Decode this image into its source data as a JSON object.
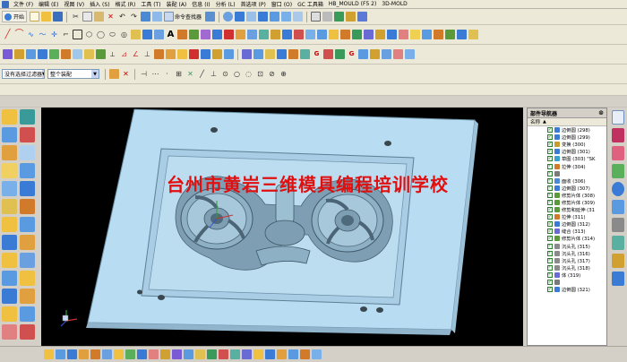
{
  "menu": {
    "items": [
      "文件 (F)",
      "编辑 (E)",
      "视图 (V)",
      "插入 (S)",
      "格式 (R)",
      "工具 (T)",
      "装配 (A)",
      "信息 (I)",
      "分析 (L)",
      "首选项 (P)",
      "窗口 (O)",
      "GC 工具箱",
      "HB_MOULD (F5 2)",
      "3D-MOLD"
    ]
  },
  "toolbar1": {
    "start_label": "开始",
    "assembly_nav_label": "命令查找器"
  },
  "selection_bar": {
    "filter_value": "没有选择过滤器",
    "scope_value": "整个装配"
  },
  "watermark": {
    "text": "台州市黄岩三维模具编程培训学校"
  },
  "part_navigator": {
    "title": "部件导航器",
    "column_header": "名称",
    "rows": [
      {
        "label": "边倒圆 (298)",
        "color": "#3a7bd5"
      },
      {
        "label": "边倒圆 (299)",
        "color": "#3a7bd5"
      },
      {
        "label": "变换 (300)",
        "color": "#c89b2f"
      },
      {
        "label": "边倒圆 (301)",
        "color": "#3a7bd5"
      },
      {
        "label": "草图 (303) \"SK",
        "color": "#3aa0d0"
      },
      {
        "label": "拉伸 (304)",
        "color": "#d07a2a"
      },
      {
        "label": "",
        "color": "#7a7a7a"
      },
      {
        "label": "面收 (306)",
        "color": "#4a8ad5"
      },
      {
        "label": "边倒圆 (307)",
        "color": "#3a7bd5"
      },
      {
        "label": "修剪片体 (308)",
        "color": "#5a9a3a"
      },
      {
        "label": "修剪片体 (309)",
        "color": "#5a9a3a"
      },
      {
        "label": "修剪和延伸 (31",
        "color": "#5a9a3a"
      },
      {
        "label": "拉伸 (311)",
        "color": "#d07a2a"
      },
      {
        "label": "边倒圆 (312)",
        "color": "#3a7bd5"
      },
      {
        "label": "缝合 (313)",
        "color": "#6a6ad5"
      },
      {
        "label": "修剪片体 (314)",
        "color": "#5a9a3a"
      },
      {
        "label": "沉头孔 (315)",
        "color": "#8a8a8a"
      },
      {
        "label": "沉头孔 (316)",
        "color": "#8a8a8a"
      },
      {
        "label": "沉头孔 (317)",
        "color": "#8a8a8a"
      },
      {
        "label": "沉头孔 (318)",
        "color": "#8a8a8a"
      },
      {
        "label": "体 (319)",
        "color": "#6a6ad5"
      },
      {
        "label": "",
        "color": "#7a7a7a"
      },
      {
        "label": "边倒圆 (321)",
        "color": "#3a7bd5"
      }
    ]
  },
  "colors": {
    "viewport_bg": "#000000",
    "plate": "#b8dcf2",
    "plate_edge": "#6a8fa6",
    "pocket": "#a9cde4",
    "cavity": "#7e9fb3",
    "watermark": "#e01010"
  },
  "icons": {
    "toolbar1": [
      "folder-open-icon",
      "save-icon",
      "cut-icon",
      "copy-icon",
      "paste-icon",
      "delete-icon",
      "undo-icon",
      "redo-icon",
      "repeat-icon",
      "find-icon",
      "cube-view-icon",
      "shaded-icon",
      "layer-icon",
      "window-icon"
    ],
    "left": [
      "sketch-icon",
      "extrude-icon",
      "revolve-icon",
      "hole-icon",
      "boss-icon",
      "pocket-icon",
      "pad-icon",
      "slot-icon",
      "groove-icon",
      "blend-icon",
      "chamfer-icon",
      "shell-icon",
      "draft-icon",
      "trim-icon",
      "split-icon",
      "offset-icon",
      "sew-icon",
      "patch-icon",
      "mirror-icon",
      "pattern-icon",
      "unite-icon",
      "subtract-icon",
      "intersect-icon",
      "measure-icon",
      "analysis-icon",
      "render-icon"
    ],
    "right": [
      "navigator-icon",
      "history-icon",
      "reuse-icon",
      "roles-icon",
      "palette-icon",
      "browser-icon",
      "process-icon",
      "help-icon",
      "web-icon",
      "recorder-icon"
    ]
  }
}
